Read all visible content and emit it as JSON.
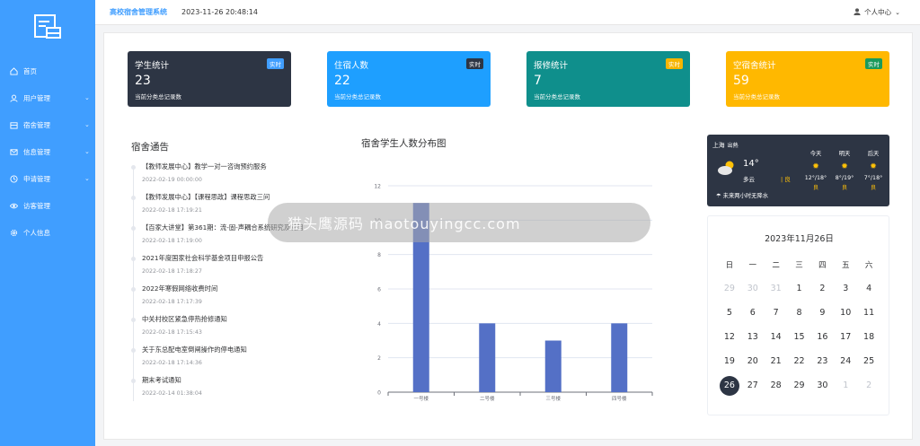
{
  "header": {
    "app_title": "高校宿舍管理系统",
    "datetime": "2023-11-26 20:48:14",
    "user_menu": "个人中心"
  },
  "sidebar": {
    "items": [
      {
        "label": "首页",
        "icon": "home-icon",
        "expandable": false
      },
      {
        "label": "用户管理",
        "icon": "user-icon",
        "expandable": true
      },
      {
        "label": "宿舍管理",
        "icon": "building-icon",
        "expandable": true
      },
      {
        "label": "信息管理",
        "icon": "mail-icon",
        "expandable": true
      },
      {
        "label": "申请管理",
        "icon": "clock-icon",
        "expandable": true
      },
      {
        "label": "访客管理",
        "icon": "eye-icon",
        "expandable": false
      },
      {
        "label": "个人信息",
        "icon": "gear-icon",
        "expandable": false
      }
    ]
  },
  "stats": [
    {
      "title": "学生统计",
      "value": "23",
      "sub": "当前分类总记录数",
      "badge": "实时",
      "color": "#2d3544",
      "badge_color": "#409eff"
    },
    {
      "title": "住宿人数",
      "value": "22",
      "sub": "当前分类总记录数",
      "badge": "实时",
      "color": "#1e9fff",
      "badge_color": "#2d3544"
    },
    {
      "title": "报修统计",
      "value": "7",
      "sub": "当前分类总记录数",
      "badge": "实时",
      "color": "#0f8f8c",
      "badge_color": "#f7b500"
    },
    {
      "title": "空宿舍统计",
      "value": "59",
      "sub": "当前分类总记录数",
      "badge": "实时",
      "color": "#ffb800",
      "badge_color": "#1a9a5b"
    }
  ],
  "announcements": {
    "title": "宿舍通告",
    "items": [
      {
        "text": "【教师发展中心】教学一对一咨询预约服务",
        "time": "2022-02-19 00:00:00"
      },
      {
        "text": "【教师发展中心】【课程思政】课程思政三问",
        "time": "2022-02-18 17:19:21"
      },
      {
        "text": "【百家大讲堂】第361期：流-固-声耦合系统研究及应用",
        "time": "2022-02-18 17:19:00"
      },
      {
        "text": "2021年度国家社会科学基金项目申报公告",
        "time": "2022-02-18 17:18:27"
      },
      {
        "text": "2022年寒假网络收费时间",
        "time": "2022-02-18 17:17:39"
      },
      {
        "text": "中关村校区紧急停热抢修通知",
        "time": "2022-02-18 17:15:43"
      },
      {
        "text": "关于东总配电室倒闸操作的停电通知",
        "time": "2022-02-18 17:14:36"
      },
      {
        "text": "期末考试通知",
        "time": "2022-02-14 01:38:04"
      }
    ]
  },
  "chart_title": "宿舍学生人数分布图",
  "chart_data": {
    "type": "bar",
    "categories": [
      "一号楼",
      "二号楼",
      "三号楼",
      "四号楼"
    ],
    "values": [
      11,
      4,
      3,
      4
    ],
    "ylim": [
      0,
      12
    ],
    "yticks": [
      0,
      2,
      4,
      6,
      8,
      10,
      12
    ],
    "color": "#5470c6",
    "grid": true
  },
  "watermark": "猫头鹰源码 maotouyingcc.com",
  "weather": {
    "city": "上海",
    "aqi_label": "出熱",
    "current_icon": "partly-cloudy-icon",
    "temp": "14°",
    "desc": "多云",
    "aqi": "| 良",
    "forecast_note": "未来两小时无降水",
    "days": [
      {
        "name": "今天",
        "range": "12°/18°",
        "quality": "良",
        "icon": "sun-icon"
      },
      {
        "name": "明天",
        "range": "8°/19°",
        "quality": "良",
        "icon": "sun-icon"
      },
      {
        "name": "后天",
        "range": "7°/18°",
        "quality": "良",
        "icon": "sun-icon"
      }
    ]
  },
  "calendar": {
    "title": "2023年11月26日",
    "weekdays": [
      "日",
      "一",
      "二",
      "三",
      "四",
      "五",
      "六"
    ],
    "weeks": [
      [
        {
          "d": "29",
          "dim": true
        },
        {
          "d": "30",
          "dim": true
        },
        {
          "d": "31",
          "dim": true
        },
        {
          "d": "1"
        },
        {
          "d": "2"
        },
        {
          "d": "3"
        },
        {
          "d": "4"
        }
      ],
      [
        {
          "d": "5"
        },
        {
          "d": "6"
        },
        {
          "d": "7"
        },
        {
          "d": "8"
        },
        {
          "d": "9"
        },
        {
          "d": "10"
        },
        {
          "d": "11"
        }
      ],
      [
        {
          "d": "12"
        },
        {
          "d": "13"
        },
        {
          "d": "14"
        },
        {
          "d": "15"
        },
        {
          "d": "16"
        },
        {
          "d": "17"
        },
        {
          "d": "18"
        }
      ],
      [
        {
          "d": "19"
        },
        {
          "d": "20"
        },
        {
          "d": "21"
        },
        {
          "d": "22"
        },
        {
          "d": "23"
        },
        {
          "d": "24"
        },
        {
          "d": "25"
        }
      ],
      [
        {
          "d": "26",
          "today": true
        },
        {
          "d": "27"
        },
        {
          "d": "28"
        },
        {
          "d": "29"
        },
        {
          "d": "30"
        },
        {
          "d": "1",
          "dim": true
        },
        {
          "d": "2",
          "dim": true
        }
      ]
    ]
  }
}
